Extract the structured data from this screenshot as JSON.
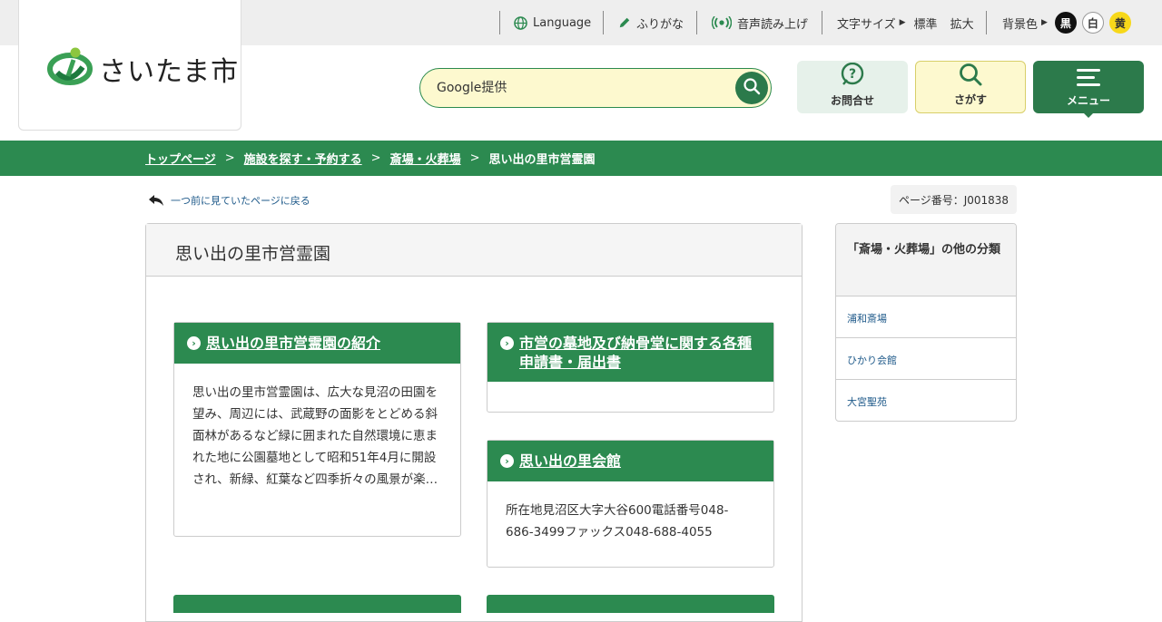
{
  "topbar": {
    "language": "Language",
    "furigana": "ふりがな",
    "voice": "音声読み上げ",
    "font_size_label": "文字サイズ",
    "font_standard": "標準",
    "font_large": "拡大",
    "bg_color_label": "背景色",
    "bg_black": "黒",
    "bg_white": "白",
    "bg_yellow": "黄"
  },
  "logo": {
    "text": "さいたま市"
  },
  "search": {
    "placeholder": "Google提供"
  },
  "header_buttons": {
    "inquiry": "お問合せ",
    "search": "さがす",
    "menu": "メニュー"
  },
  "breadcrumb": [
    "トップページ",
    "施設を探す・予約する",
    "斎場・火葬場",
    "思い出の里市営霊園"
  ],
  "back_link": "一つ前に見ていたページに戻る",
  "page_number": "ページ番号：J001838",
  "main": {
    "title": "思い出の里市営霊園",
    "cards": [
      {
        "title": "思い出の里市営霊園の紹介",
        "body": "思い出の里市営霊園は、広大な見沼の田園を望み、周辺には、武蔵野の面影をとどめる斜面林があるなど緑に囲まれた自然環境に恵まれた地に公園墓地として昭和51年4月に開設され、新緑、紅葉など四季折々の風景が楽…"
      },
      {
        "title": "市営の墓地及び納骨堂に関する各種申請書・届出書",
        "body": ""
      },
      {
        "title": "思い出の里会館",
        "body": "所在地見沼区大字大谷600電話番号048-686-3499ファックス048-688-4055"
      }
    ]
  },
  "side": {
    "title": "「斎場・火葬場」の他の分類",
    "items": [
      "浦和斎場",
      "ひかり会館",
      "大宮聖苑"
    ]
  },
  "colors": {
    "brand_green": "#2c8a50",
    "search_bg": "#fdf9cf",
    "yellow_button": "#fdf9cf",
    "inquiry_bg": "#e6f1ea"
  }
}
